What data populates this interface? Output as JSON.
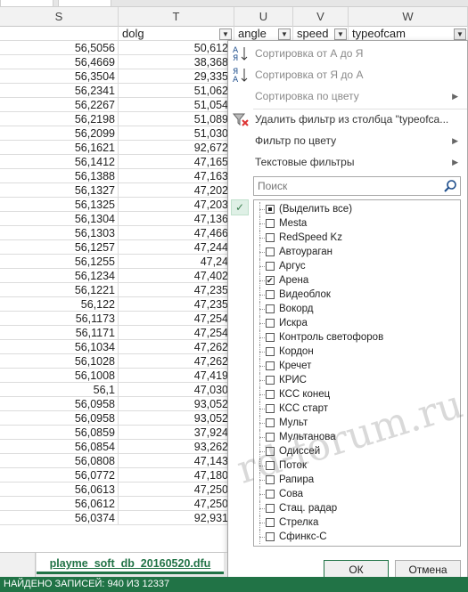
{
  "column_letters": [
    "S",
    "T",
    "U",
    "V",
    "W"
  ],
  "headers": {
    "S": "",
    "T": "dolg",
    "U": "angle",
    "V": "speed",
    "W": "typeofcam"
  },
  "rows": [
    {
      "s": "56,5056",
      "t": "50,612"
    },
    {
      "s": "56,4669",
      "t": "38,368"
    },
    {
      "s": "56,3504",
      "t": "29,335"
    },
    {
      "s": "56,2341",
      "t": "51,062"
    },
    {
      "s": "56,2267",
      "t": "51,054"
    },
    {
      "s": "56,2198",
      "t": "51,089"
    },
    {
      "s": "56,2099",
      "t": "51,030"
    },
    {
      "s": "56,1621",
      "t": "92,672"
    },
    {
      "s": "56,1412",
      "t": "47,165"
    },
    {
      "s": "56,1388",
      "t": "47,163"
    },
    {
      "s": "56,1327",
      "t": "47,202"
    },
    {
      "s": "56,1325",
      "t": "47,203"
    },
    {
      "s": "56,1304",
      "t": "47,136"
    },
    {
      "s": "56,1303",
      "t": "47,466"
    },
    {
      "s": "56,1257",
      "t": "47,244"
    },
    {
      "s": "56,1255",
      "t": "47,24"
    },
    {
      "s": "56,1234",
      "t": "47,402"
    },
    {
      "s": "56,1221",
      "t": "47,235"
    },
    {
      "s": "56,122",
      "t": "47,235"
    },
    {
      "s": "56,1173",
      "t": "47,254"
    },
    {
      "s": "56,1171",
      "t": "47,254"
    },
    {
      "s": "56,1034",
      "t": "47,262"
    },
    {
      "s": "56,1028",
      "t": "47,262"
    },
    {
      "s": "56,1008",
      "t": "47,419"
    },
    {
      "s": "56,1",
      "t": "47,030"
    },
    {
      "s": "56,0958",
      "t": "93,052"
    },
    {
      "s": "56,0958",
      "t": "93,052"
    },
    {
      "s": "56,0859",
      "t": "37,924"
    },
    {
      "s": "56,0854",
      "t": "93,262"
    },
    {
      "s": "56,0808",
      "t": "47,143"
    },
    {
      "s": "56,0772",
      "t": "47,180"
    },
    {
      "s": "56,0613",
      "t": "47,250"
    },
    {
      "s": "56,0612",
      "t": "47,250"
    },
    {
      "s": "56,0374",
      "t": "92,931"
    }
  ],
  "filter_menu": {
    "sort_asc": "Сортировка от А до Я",
    "sort_desc": "Сортировка от Я до А",
    "sort_color": "Сортировка по цвету",
    "clear_filter": "Удалить фильтр из столбца \"typeofca...",
    "filter_color": "Фильтр по цвету",
    "text_filters": "Текстовые фильтры",
    "search_placeholder": "Поиск",
    "ok": "ОК",
    "cancel": "Отмена"
  },
  "filter_values": [
    {
      "label": "(Выделить все)",
      "state": "partial"
    },
    {
      "label": "Mesta",
      "state": "unchecked"
    },
    {
      "label": "RedSpeed Kz",
      "state": "unchecked"
    },
    {
      "label": "Автоураган",
      "state": "unchecked"
    },
    {
      "label": "Аргус",
      "state": "unchecked"
    },
    {
      "label": "Арена",
      "state": "checked"
    },
    {
      "label": "Видеоблок",
      "state": "unchecked"
    },
    {
      "label": "Вокорд",
      "state": "unchecked"
    },
    {
      "label": "Искра",
      "state": "unchecked"
    },
    {
      "label": "Контроль светофоров",
      "state": "unchecked"
    },
    {
      "label": "Кордон",
      "state": "unchecked"
    },
    {
      "label": "Кречет",
      "state": "unchecked"
    },
    {
      "label": "КРИС",
      "state": "unchecked"
    },
    {
      "label": "КСС конец",
      "state": "unchecked"
    },
    {
      "label": "КСС старт",
      "state": "unchecked"
    },
    {
      "label": "Мульт",
      "state": "unchecked"
    },
    {
      "label": "Мультанова",
      "state": "unchecked"
    },
    {
      "label": "Одиссей",
      "state": "unchecked"
    },
    {
      "label": "Поток",
      "state": "unchecked"
    },
    {
      "label": "Рапира",
      "state": "unchecked"
    },
    {
      "label": "Сова",
      "state": "unchecked"
    },
    {
      "label": "Стац. радар",
      "state": "unchecked"
    },
    {
      "label": "Стрелка",
      "state": "unchecked"
    },
    {
      "label": "Сфинкс-С",
      "state": "unchecked"
    }
  ],
  "sheet_tab": "playme_soft_db_20160520.dfu",
  "status_text": "НАЙДЕНО ЗАПИСЕЙ: 940 ИЗ 12337",
  "watermark": "rd-forum.ru",
  "colors": {
    "accent": "#217346",
    "menu_icon": "#1e4e8c"
  }
}
